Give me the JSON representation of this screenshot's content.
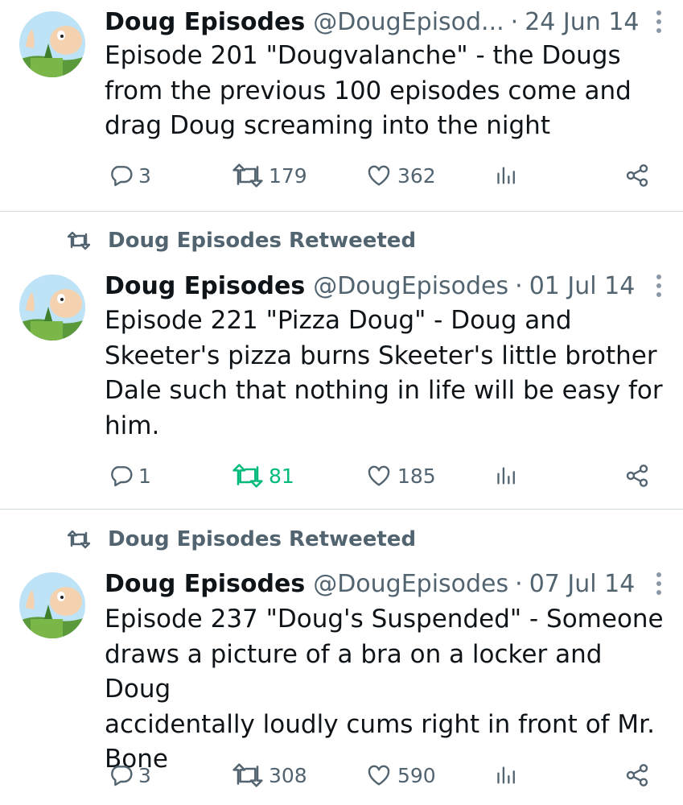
{
  "tweets": [
    {
      "retweeted_by": "",
      "name": "Doug Episodes",
      "handle": "@DougEpisod...",
      "date": "24 Jun 14",
      "lines": [
        "Episode 201 \"Dougvalanche\" - the Dougs",
        "from the previous 100 episodes come and",
        "drag Doug screaming into the night"
      ],
      "replies": "3",
      "retweets": "179",
      "likes": "362",
      "retweeted": false
    },
    {
      "retweeted_by": "Doug Episodes Retweeted",
      "name": "Doug Episodes",
      "handle": "@DougEpisodes",
      "date": "01 Jul 14",
      "lines": [
        "Episode 221 \"Pizza Doug\" - Doug and",
        "Skeeter's pizza burns Skeeter's little brother",
        "Dale such that nothing in life will be easy for",
        "him."
      ],
      "replies": "1",
      "retweets": "81",
      "likes": "185",
      "retweeted": true
    },
    {
      "retweeted_by": "Doug Episodes Retweeted",
      "name": "Doug Episodes",
      "handle": "@DougEpisodes",
      "date": "07 Jul 14",
      "lines": [
        "Episode 237 \"Doug's Suspended\" - Someone",
        "draws a picture of a bra on a locker and Doug",
        "accidentally loudly cums right in front of Mr.",
        "Bone"
      ],
      "replies": "3",
      "retweets": "308",
      "likes": "590",
      "retweeted": false
    }
  ],
  "icons": {
    "reply": "reply-icon",
    "retweet": "retweet-icon",
    "like": "heart-icon",
    "views": "views-icon",
    "share": "share-icon",
    "more": "more-icon"
  },
  "colors": {
    "text": "#0f1419",
    "muted": "#536471",
    "retweet_active": "#00ba7c",
    "divider": "#cfd9de"
  }
}
